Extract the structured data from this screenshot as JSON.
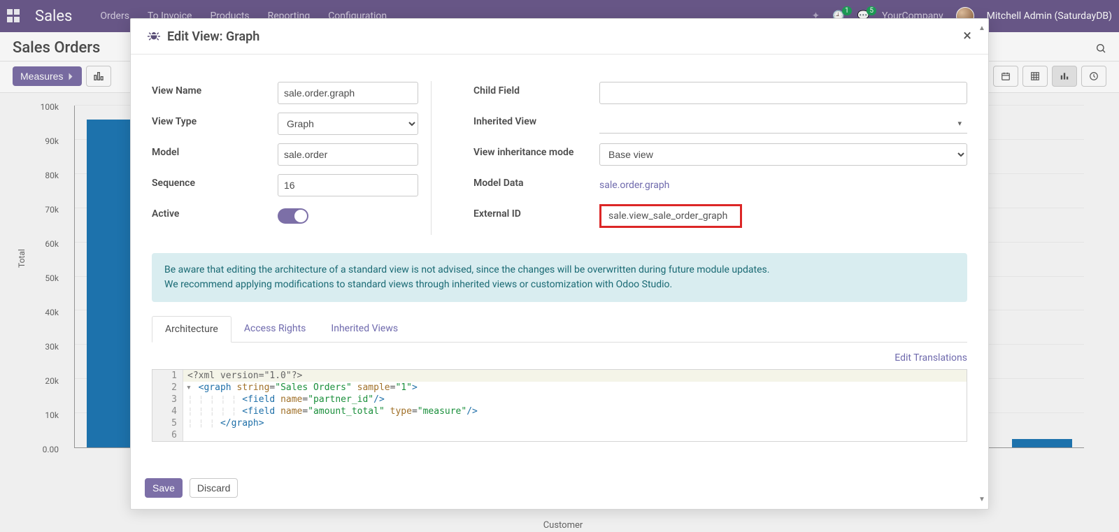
{
  "navbar": {
    "brand": "Sales",
    "menus": [
      "Orders",
      "To Invoice",
      "Products",
      "Reporting",
      "Configuration"
    ],
    "badge1": "1",
    "badge2": "5",
    "company": "YourCompany",
    "user": "Mitchell Admin (SaturdayDB)"
  },
  "subheader": {
    "title": "Sales Orders"
  },
  "controls": {
    "measures": "Measures"
  },
  "chart_data": {
    "type": "bar",
    "title": "Sales Orders",
    "xlabel": "Customer",
    "ylabel": "Total",
    "ylim": [
      0,
      100000
    ],
    "yticks": [
      "0.00",
      "10k",
      "20k",
      "30k",
      "40k",
      "50k",
      "60k",
      "70k",
      "80k",
      "90k",
      "100k"
    ],
    "categories": [
      "",
      "",
      "",
      "",
      "",
      "",
      "",
      "",
      "",
      "",
      "",
      ""
    ],
    "values": [
      96000,
      0,
      0,
      0,
      0,
      0,
      0,
      0,
      0,
      0,
      0,
      2500
    ]
  },
  "modal": {
    "title": "Edit View: Graph",
    "leftLabels": {
      "viewName": "View Name",
      "viewType": "View Type",
      "model": "Model",
      "sequence": "Sequence",
      "active": "Active"
    },
    "rightLabels": {
      "childField": "Child Field",
      "inheritedView": "Inherited View",
      "inheritMode": "View inheritance mode",
      "modelData": "Model Data",
      "externalId": "External ID"
    },
    "values": {
      "viewName": "sale.order.graph",
      "viewType": "Graph",
      "model": "sale.order",
      "sequence": "16",
      "childField": "",
      "inheritedView": "",
      "inheritMode": "Base view",
      "modelData": "sale.order.graph",
      "externalId": "sale.view_sale_order_graph"
    },
    "callout": {
      "line1": "Be aware that editing the architecture of a standard view is not advised, since the changes will be overwritten during future module updates.",
      "line2": "We recommend applying modifications to standard views through inherited views or customization with Odoo Studio."
    },
    "tabs": [
      "Architecture",
      "Access Rights",
      "Inherited Views"
    ],
    "editTranslations": "Edit Translations",
    "editor": {
      "lines": [
        {
          "n": "1",
          "plain": "<?xml version=\"1.0\"?>"
        },
        {
          "n": "2",
          "fold": "▾",
          "html": "<span class='tag'>&lt;graph</span> <span class='attr'>string</span>=<span class='str'>\"Sales Orders\"</span> <span class='attr'>sample</span>=<span class='str'>\"1\"</span><span class='tag'>&gt;</span>"
        },
        {
          "n": "3",
          "indent": 10,
          "html": "<span class='tag'>&lt;field</span> <span class='attr'>name</span>=<span class='str'>\"partner_id\"</span><span class='tag'>/&gt;</span>"
        },
        {
          "n": "4",
          "indent": 10,
          "html": "<span class='tag'>&lt;field</span> <span class='attr'>name</span>=<span class='str'>\"amount_total\"</span> <span class='attr'>type</span>=<span class='str'>\"measure\"</span><span class='tag'>/&gt;</span>"
        },
        {
          "n": "5",
          "indent": 6,
          "html": "<span class='tag'>&lt;/graph&gt;</span>"
        },
        {
          "n": "6",
          "html": ""
        }
      ]
    },
    "save": "Save",
    "discard": "Discard"
  }
}
